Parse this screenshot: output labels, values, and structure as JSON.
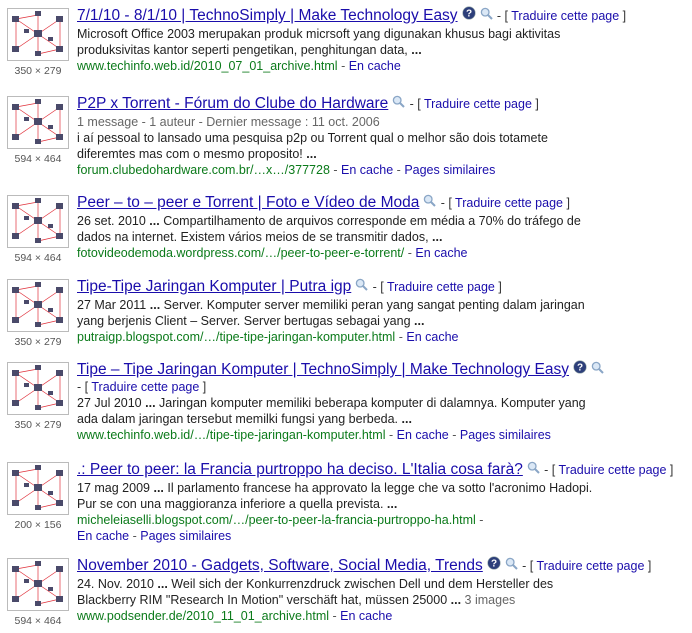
{
  "translate_label": "Traduire cette page",
  "cache_label": "En cache",
  "similar_label": "Pages similaires",
  "results": [
    {
      "dims": "350 × 279",
      "title": "7/1/10 - 8/1/10 | TechnoSimply | Make Technology Easy",
      "snippet1": "Microsoft Office 2003 merupakan produk micrsoft yang digunakan khusus bagi aktivitas",
      "snippet2": "produksivitas kantor seperti pengetikan, penghitungan data,",
      "url": "www.techinfo.web.id/2010_07_01_archive.html"
    },
    {
      "dims": "594 × 464",
      "title": "P2P x Torrent - Fórum do Clube do Hardware",
      "meta": "1 message - 1 auteur - Dernier message : 11 oct. 2006",
      "snippet1": "i aí pessoal to lansado uma pesquisa p2p ou Torrent qual o melhor são dois totamete",
      "snippet2": "diferemtes mas com o mesmo proposito!",
      "url": "forum.clubedohardware.com.br/…x…/377728"
    },
    {
      "dims": "594 × 464",
      "title": "Peer – to – peer e Torrent | Foto e Vídeo de Moda",
      "date": "26 set. 2010",
      "snippet1": "Compartilhamento de arquivos corresponde em média a 70% do tráfego de",
      "snippet2": "dados na internet. Existem vários meios de se transmitir dados,",
      "url": "fotovideodemoda.wordpress.com/…/peer-to-peer-e-torrent/"
    },
    {
      "dims": "350 × 279",
      "title": "Tipe-Tipe Jaringan Komputer | Putra igp",
      "date": "27 Mar 2011",
      "snippet1": "Server. Komputer server memiliki peran yang sangat penting dalam jaringan",
      "snippet2": "yang berjenis Client – Server. Server bertugas sebagai yang",
      "url": "putraigp.blogspot.com/…/tipe-tipe-jaringan-komputer.html"
    },
    {
      "dims": "350 × 279",
      "title": "Tipe – Tipe Jaringan Komputer | TechnoSimply | Make Technology Easy",
      "date": "27 Jul 2010",
      "snippet1": "Jaringan komputer memiliki beberapa komputer di dalamnya. Komputer yang",
      "snippet2": "ada dalam jaringan tersebut memilki fungsi yang berbeda.",
      "url": "www.techinfo.web.id/…/tipe-tipe-jaringan-komputer.html"
    },
    {
      "dims": "200 × 156",
      "title": ".: Peer to peer: la Francia purtroppo ha deciso. L'Italia cosa farà?",
      "date": "17 mag 2009",
      "snippet1": "Il parlamento francese ha approvato la legge che va sotto l'acronimo Hadopi.",
      "snippet2": "Pur se con una maggioranza inferiore a quella prevista.",
      "url": "micheleiaselli.blogspot.com/…/peer-to-peer-la-francia-purtroppo-ha.html"
    },
    {
      "dims": "594 × 464",
      "title": "November 2010 - Gadgets, Software, Social Media, Trends",
      "date": "24. Nov. 2010",
      "snippet1": "Weil sich der Konkurrenzdruck zwischen Dell und dem Hersteller des",
      "snippet2": "Blackberry RIM \"Research In Motion\" verschäft hat, müssen 25000",
      "extra": "3 images",
      "url": "www.podsender.de/2010_11_01_archive.html"
    }
  ]
}
